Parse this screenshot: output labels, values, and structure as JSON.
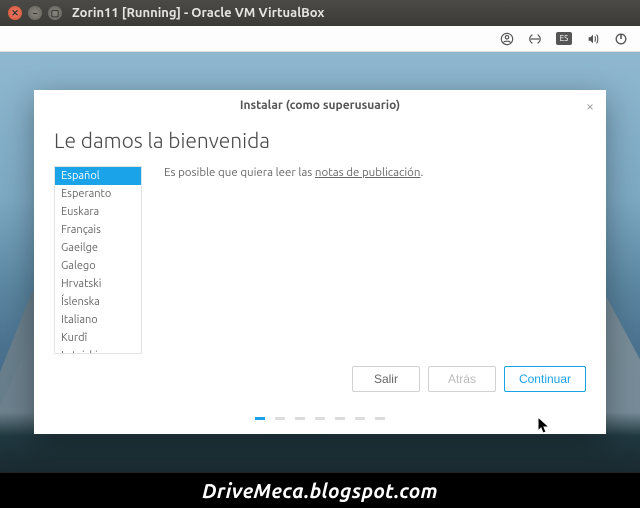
{
  "window": {
    "title": "Zorin11 [Running] - Oracle VM VirtualBox"
  },
  "modal": {
    "title": "Instalar (como superusuario)",
    "heading": "Le damos la bienvenida",
    "close": "×",
    "content_prefix": "Es posible que quiera leer las ",
    "content_link": "notas de publicación",
    "content_suffix": "."
  },
  "languages": [
    "Español",
    "Esperanto",
    "Euskara",
    "Français",
    "Gaeilge",
    "Galego",
    "Hrvatski",
    "Íslenska",
    "Italiano",
    "Kurdî",
    "Latviski"
  ],
  "selected_language_index": 0,
  "buttons": {
    "exit": "Salir",
    "back": "Atrás",
    "continue": "Continuar"
  },
  "step": {
    "current": 1,
    "total": 7
  },
  "caption": "DriveMeca.blogspot.com"
}
